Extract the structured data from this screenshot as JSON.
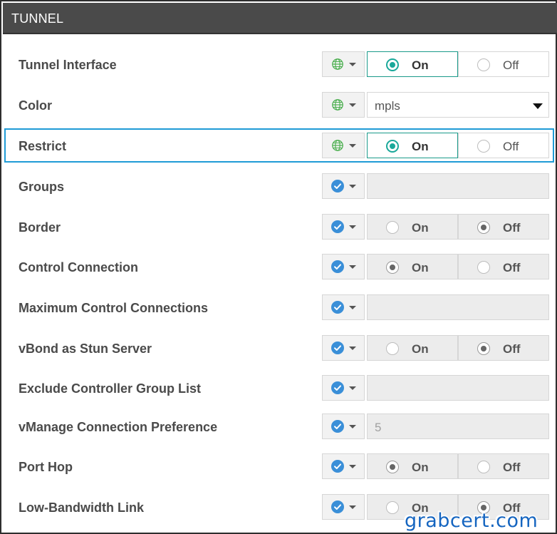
{
  "section_title": "TUNNEL",
  "watermark": "grabcert.com",
  "colors": {
    "accent_teal": "#1aa89a",
    "highlight_blue": "#1f9bd6",
    "check_blue": "#3a8fd8",
    "header_bg": "#4a4a4a"
  },
  "rows": [
    {
      "label": "Tunnel Interface",
      "scope_icon": "globe-icon",
      "control": "toggle",
      "on_label": "On",
      "off_label": "Off",
      "selected": "On"
    },
    {
      "label": "Color",
      "scope_icon": "globe-icon",
      "control": "select",
      "value": "mpls"
    },
    {
      "label": "Restrict",
      "scope_icon": "globe-icon",
      "control": "toggle",
      "on_label": "On",
      "off_label": "Off",
      "selected": "On",
      "highlighted": true
    },
    {
      "label": "Groups",
      "scope_icon": "check-circle-icon",
      "control": "input",
      "value": ""
    },
    {
      "label": "Border",
      "scope_icon": "check-circle-icon",
      "control": "toggle",
      "on_label": "On",
      "off_label": "Off",
      "selected": "Off"
    },
    {
      "label": "Control Connection",
      "scope_icon": "check-circle-icon",
      "control": "toggle",
      "on_label": "On",
      "off_label": "Off",
      "selected": "On"
    },
    {
      "label": "Maximum Control Connections",
      "scope_icon": "check-circle-icon",
      "control": "input",
      "value": ""
    },
    {
      "label": "vBond as Stun Server",
      "scope_icon": "check-circle-icon",
      "control": "toggle",
      "on_label": "On",
      "off_label": "Off",
      "selected": "Off"
    },
    {
      "label": "Exclude Controller Group List",
      "scope_icon": "check-circle-icon",
      "control": "input",
      "value": ""
    },
    {
      "label": "vManage Connection Preference",
      "scope_icon": "check-circle-icon",
      "control": "input",
      "value": "5"
    },
    {
      "label": "Port Hop",
      "scope_icon": "check-circle-icon",
      "control": "toggle",
      "on_label": "On",
      "off_label": "Off",
      "selected": "On"
    },
    {
      "label": "Low-Bandwidth Link",
      "scope_icon": "check-circle-icon",
      "control": "toggle",
      "on_label": "On",
      "off_label": "Off",
      "selected": "Off"
    }
  ]
}
